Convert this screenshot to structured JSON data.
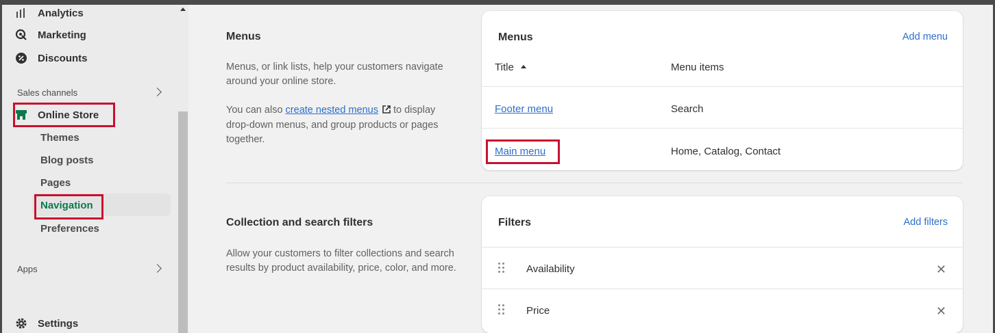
{
  "sidebar": {
    "items_top": [
      {
        "label": "Analytics",
        "icon": "analytics-icon"
      },
      {
        "label": "Marketing",
        "icon": "marketing-icon"
      },
      {
        "label": "Discounts",
        "icon": "discounts-icon"
      }
    ],
    "sales_channels_label": "Sales channels",
    "online_store": {
      "label": "Online Store",
      "icon": "store-icon"
    },
    "online_store_sub": [
      "Themes",
      "Blog posts",
      "Pages",
      "Navigation",
      "Preferences"
    ],
    "apps_label": "Apps",
    "settings": {
      "label": "Settings",
      "icon": "gear-icon"
    }
  },
  "menus_section": {
    "title": "Menus",
    "desc1": "Menus, or link lists, help your customers navigate around your online store.",
    "desc2_prefix": "You can also ",
    "desc2_link": "create nested menus",
    "desc2_suffix": " to display drop-down menus, and group products or pages together."
  },
  "menus_card": {
    "title": "Menus",
    "action": "Add menu",
    "col_title": "Title",
    "col_items": "Menu items",
    "rows": [
      {
        "title": "Footer menu",
        "items": "Search"
      },
      {
        "title": "Main menu",
        "items": "Home, Catalog, Contact"
      }
    ]
  },
  "filters_section": {
    "title": "Collection and search filters",
    "desc": "Allow your customers to filter collections and search results by product availability, price, color, and more."
  },
  "filters_card": {
    "title": "Filters",
    "action": "Add filters",
    "rows": [
      {
        "label": "Availability"
      },
      {
        "label": "Price"
      }
    ]
  },
  "colors": {
    "accent": "#2c6ecb",
    "active_green": "#0a7a4a",
    "highlight_red": "#c8102e"
  }
}
